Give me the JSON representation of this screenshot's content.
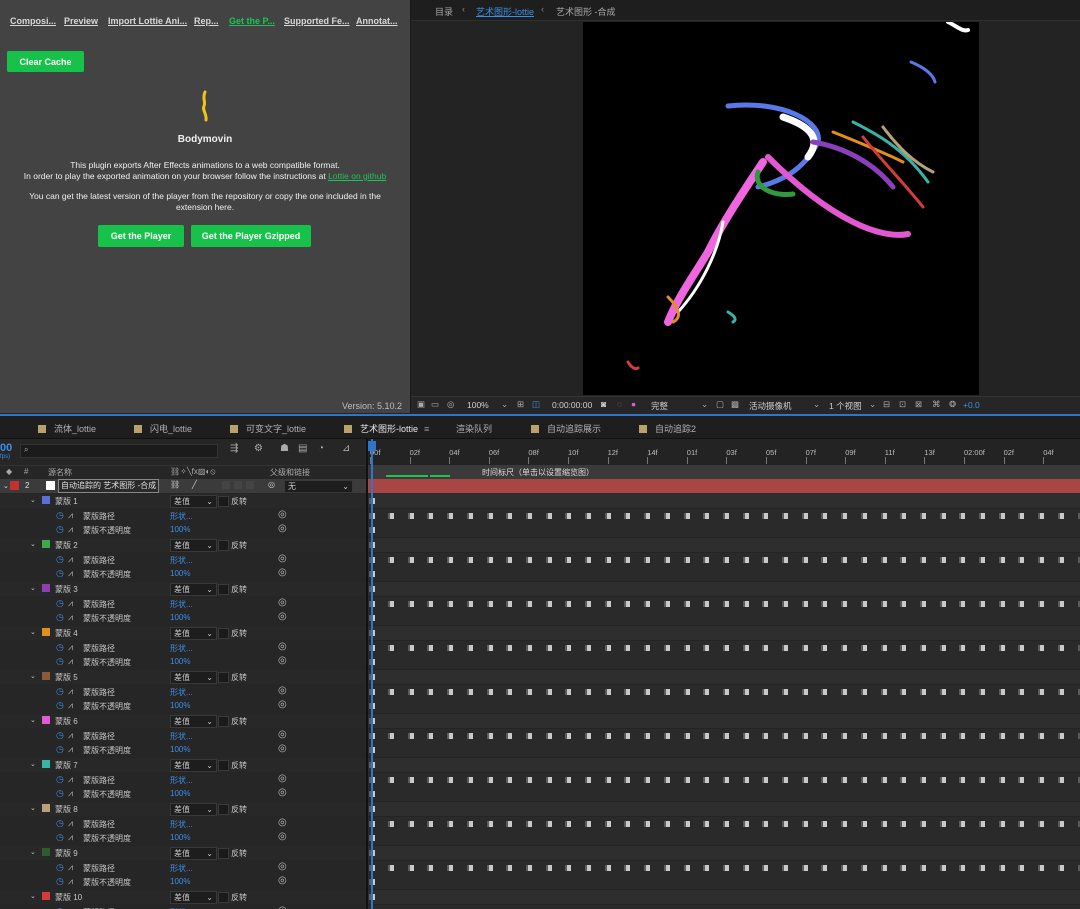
{
  "bodymovin": {
    "tabs": [
      "Composi...",
      "Preview",
      "Import Lottie Ani...",
      "Rep...",
      "Get the P...",
      "Supported Fe...",
      "Annotat..."
    ],
    "active_tab": 4,
    "clear_cache": "Clear Cache",
    "title": "Bodymovin",
    "desc1": "This plugin exports After Effects animations to a web compatible format.",
    "desc2": "In order to play the exported animation on your browser follow the instructions at",
    "link": "Lottie on github",
    "desc3": "You can get the latest version of the player from the repository or copy the one included in the",
    "desc4": "extension here.",
    "btn_player": "Get the Player",
    "btn_gzipped": "Get the Player Gzipped",
    "version": "Version: 5.10.2"
  },
  "viewer": {
    "breadcrumb_root": "目录",
    "comp_active": "艺术图形-lottie",
    "comp_next": "艺术图形 -合成",
    "zoom": "100%",
    "timecode": "0:00:00:00",
    "quality": "完整",
    "camera": "活动摄像机",
    "views": "1 个视图",
    "exposure": "+0.0"
  },
  "timeline": {
    "tabs": [
      "流体_lottie",
      "闪电_lottie",
      "可变文字_lottie",
      "艺术图形-lottie",
      "渲染队列",
      "自动追踪展示",
      "自动追踪2"
    ],
    "active_tab": 3,
    "time_display": "00",
    "fps": "fps)",
    "search_placeholder": "",
    "col_num": "#",
    "col_name": "源名称",
    "col_parent": "父级和链接",
    "layer_num": "2",
    "layer_name": "自动追踪的 艺术图形 -合成",
    "parent_value": "无",
    "tooltip": "时间标尺（单击以设置缩览图）",
    "ruler": [
      "00f",
      "02f",
      "04f",
      "06f",
      "08f",
      "10f",
      "12f",
      "14f",
      "01f",
      "03f",
      "05f",
      "07f",
      "09f",
      "11f",
      "13f",
      "02:00f",
      "02f",
      "04f"
    ],
    "mode_label": "差值",
    "invert_label": "反转",
    "path_label": "蒙版路径",
    "opacity_label": "蒙版不透明度",
    "path_value": "形状...",
    "opacity_value": "100%",
    "masks": [
      {
        "name": "蒙版 1",
        "color": "#5b6fd6"
      },
      {
        "name": "蒙版 2",
        "color": "#3fa84a"
      },
      {
        "name": "蒙版 3",
        "color": "#8e3fb0"
      },
      {
        "name": "蒙版 4",
        "color": "#e38f1b"
      },
      {
        "name": "蒙版 5",
        "color": "#8a5a3c"
      },
      {
        "name": "蒙版 6",
        "color": "#e35bd3"
      },
      {
        "name": "蒙版 7",
        "color": "#38b3a8"
      },
      {
        "name": "蒙版 8",
        "color": "#b7a07a"
      },
      {
        "name": "蒙版 9",
        "color": "#2f5c2f"
      },
      {
        "name": "蒙版 10",
        "color": "#d43c3c"
      }
    ]
  }
}
